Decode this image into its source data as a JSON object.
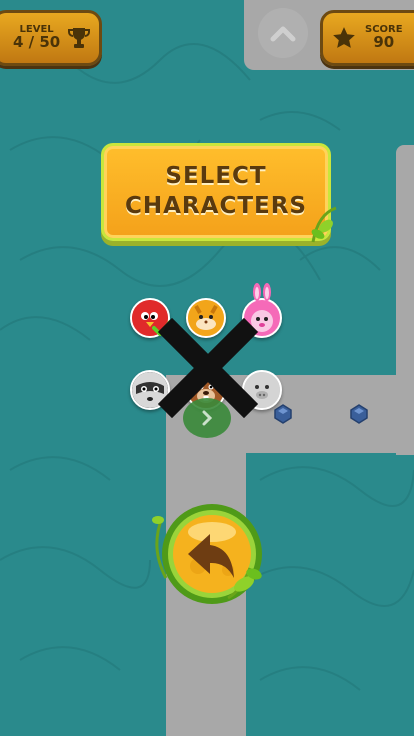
{
  "level": {
    "label": "LEVEL",
    "value": "4 / 50",
    "icon": "trophy-icon"
  },
  "score": {
    "label": "SCORE",
    "value": "90",
    "icon": "star-icon"
  },
  "banner": {
    "line1": "SELECT",
    "line2": "CHARACTERS"
  },
  "characters": [
    {
      "name": "red-bird",
      "color": "#e02a2a",
      "selected": true
    },
    {
      "name": "hamster",
      "color": "#f2a51a",
      "selected": false
    },
    {
      "name": "bunny",
      "color": "#f2a0d2",
      "selected": false
    },
    {
      "name": "raccoon",
      "color": "#5a5a5a",
      "selected": false
    },
    {
      "name": "beaver",
      "color": "#8a4a20",
      "selected": false
    },
    {
      "name": "pig",
      "color": "#c8c8c8",
      "selected": false
    }
  ],
  "colors": {
    "water": "#2a8a8c",
    "road": "#a8a8a8",
    "hud": "#e8a820",
    "banner": "#f7b223"
  }
}
